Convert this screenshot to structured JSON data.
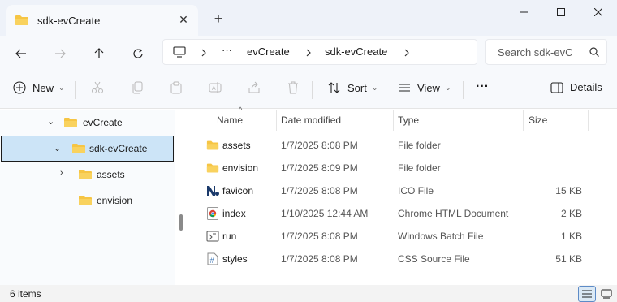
{
  "window": {
    "tab_title": "sdk-evCreate",
    "new_tab_glyph": "+",
    "close_tab_glyph": "✕"
  },
  "address_bar": {
    "overflow": "···",
    "segments": [
      "evCreate",
      "sdk-evCreate"
    ],
    "search_placeholder": "Search sdk-evC"
  },
  "toolbar": {
    "new_label": "New",
    "sort_label": "Sort",
    "view_label": "View",
    "more_glyph": "···",
    "details_label": "Details"
  },
  "sidebar": {
    "items": [
      {
        "label": "evCreate"
      },
      {
        "label": "sdk-evCreate"
      },
      {
        "label": "assets"
      },
      {
        "label": "envision"
      }
    ]
  },
  "columns": {
    "name": "Name",
    "date": "Date modified",
    "type": "Type",
    "size": "Size"
  },
  "files": [
    {
      "name": "assets",
      "date": "1/7/2025 8:08 PM",
      "type": "File folder",
      "size": "",
      "icon": "folder-icon"
    },
    {
      "name": "envision",
      "date": "1/7/2025 8:09 PM",
      "type": "File folder",
      "size": "",
      "icon": "folder-icon"
    },
    {
      "name": "favicon",
      "date": "1/7/2025 8:08 PM",
      "type": "ICO File",
      "size": "15 KB",
      "icon": "ico-file-icon"
    },
    {
      "name": "index",
      "date": "1/10/2025 12:44 AM",
      "type": "Chrome HTML Document",
      "size": "2 KB",
      "icon": "chrome-html-icon"
    },
    {
      "name": "run",
      "date": "1/7/2025 8:08 PM",
      "type": "Windows Batch File",
      "size": "1 KB",
      "icon": "batch-file-icon"
    },
    {
      "name": "styles",
      "date": "1/7/2025 8:08 PM",
      "type": "CSS Source File",
      "size": "51 KB",
      "icon": "css-file-icon"
    }
  ],
  "status": {
    "item_count": "6 items"
  },
  "colors": {
    "folder": "#f6c544",
    "accent": "#0067c0",
    "selection": "#cce4f7"
  }
}
